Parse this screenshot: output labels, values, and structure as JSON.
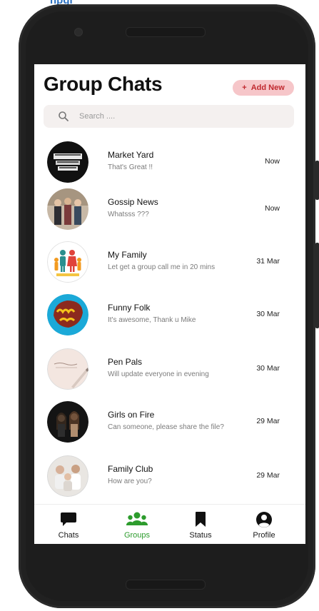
{
  "page_header_fragment": "hpgi",
  "screen": {
    "title": "Group Chats",
    "add_new_label": "Add New",
    "add_new_plus": "+",
    "search_placeholder": "Search ...."
  },
  "groups": [
    {
      "name": "Market Yard",
      "message": "That's Great !!",
      "time": "Now",
      "avatar": "market-yard-logo"
    },
    {
      "name": "Gossip News",
      "message": "Whatsss ???",
      "time": "Now",
      "avatar": "gossip-news-photo"
    },
    {
      "name": "My Family",
      "message": "Let get a group call me in 20 mins",
      "time": "31 Mar",
      "avatar": "my-family-logo"
    },
    {
      "name": "Funny Folk",
      "message": "It's awesome, Thank u Mike",
      "time": "30 Mar",
      "avatar": "funny-folk-logo"
    },
    {
      "name": "Pen Pals",
      "message": "Will update everyone in evening",
      "time": "30 Mar",
      "avatar": "pen-pals-photo"
    },
    {
      "name": "Girls on Fire",
      "message": "Can someone, please share the file?",
      "time": "29 Mar",
      "avatar": "girls-on-fire-photo"
    },
    {
      "name": "Family Club",
      "message": "How are you?",
      "time": "29 Mar",
      "avatar": "family-club-photo"
    }
  ],
  "nav": {
    "items": [
      {
        "label": "Chats",
        "icon": "chat-bubble-icon",
        "active": false
      },
      {
        "label": "Groups",
        "icon": "groups-icon",
        "active": true
      },
      {
        "label": "Status",
        "icon": "bookmark-icon",
        "active": false
      },
      {
        "label": "Profile",
        "icon": "profile-icon",
        "active": false
      }
    ]
  },
  "colors": {
    "accent_green": "#2d9c2d",
    "add_button_bg": "#f6c6c9",
    "add_button_text": "#c0292f",
    "phone_body": "#212121"
  }
}
